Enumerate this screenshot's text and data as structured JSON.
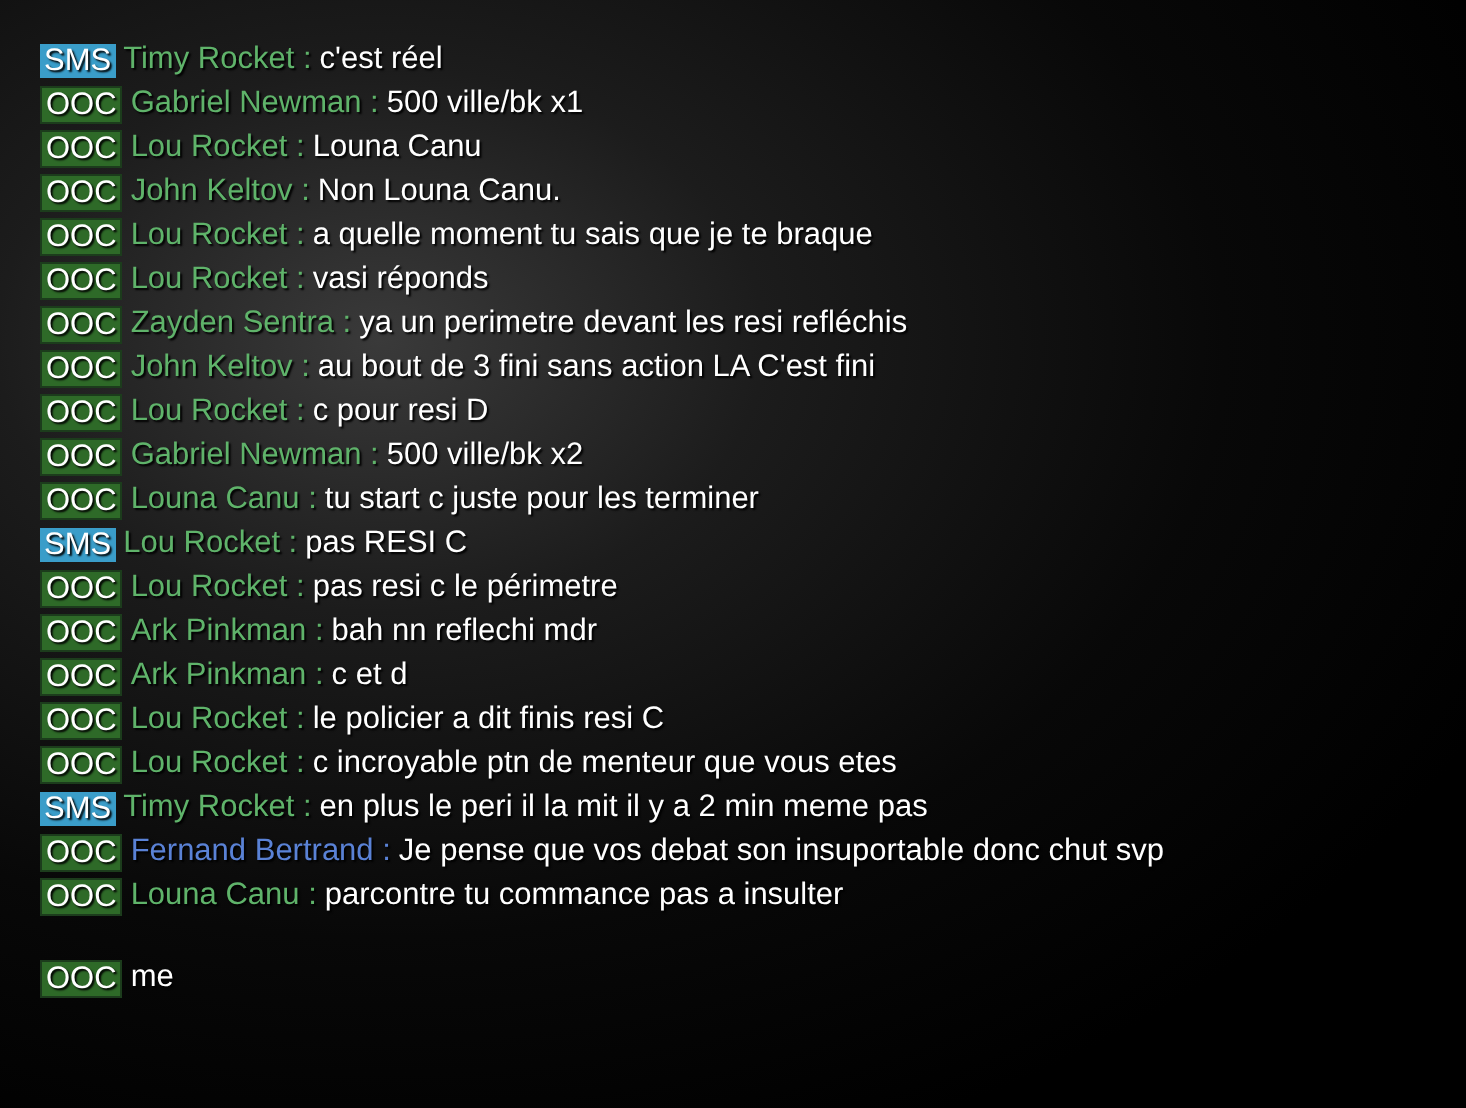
{
  "messages": [
    {
      "channel": "SMS",
      "kind": "sms",
      "name": "Timy Rocket :",
      "color": "#5fb36a",
      "text": "c'est réel"
    },
    {
      "channel": "OOC",
      "kind": "ooc",
      "name": "Gabriel Newman :",
      "color": "#5fb36a",
      "text": "500 ville/bk x1"
    },
    {
      "channel": "OOC",
      "kind": "ooc",
      "name": "Lou Rocket :",
      "color": "#5fb36a",
      "text": "Louna Canu"
    },
    {
      "channel": "OOC",
      "kind": "ooc",
      "name": "John Keltov :",
      "color": "#5fb36a",
      "text": "Non Louna Canu."
    },
    {
      "channel": "OOC",
      "kind": "ooc",
      "name": "Lou Rocket :",
      "color": "#5fb36a",
      "text": "a quelle moment tu sais que je te braque"
    },
    {
      "channel": "OOC",
      "kind": "ooc",
      "name": "Lou Rocket :",
      "color": "#5fb36a",
      "text": "vasi réponds"
    },
    {
      "channel": "OOC",
      "kind": "ooc",
      "name": "Zayden Sentra :",
      "color": "#5fb36a",
      "text": "ya un perimetre devant les resi refléchis"
    },
    {
      "channel": "OOC",
      "kind": "ooc",
      "name": "John Keltov :",
      "color": "#5fb36a",
      "text": "au bout de 3 fini sans action LA C'est fini"
    },
    {
      "channel": "OOC",
      "kind": "ooc",
      "name": "Lou Rocket :",
      "color": "#5fb36a",
      "text": "c pour resi D"
    },
    {
      "channel": "OOC",
      "kind": "ooc",
      "name": "Gabriel Newman :",
      "color": "#5fb36a",
      "text": "500 ville/bk x2"
    },
    {
      "channel": "OOC",
      "kind": "ooc",
      "name": "Louna Canu :",
      "color": "#5fb36a",
      "text": "tu start c juste pour les terminer"
    },
    {
      "channel": "SMS",
      "kind": "sms",
      "name": "Lou Rocket :",
      "color": "#5fb36a",
      "text": "pas RESI C"
    },
    {
      "channel": "OOC",
      "kind": "ooc",
      "name": "Lou Rocket :",
      "color": "#5fb36a",
      "text": "pas resi c le périmetre"
    },
    {
      "channel": "OOC",
      "kind": "ooc",
      "name": "Ark Pinkman :",
      "color": "#5fb36a",
      "text": "bah nn reflechi mdr"
    },
    {
      "channel": "OOC",
      "kind": "ooc",
      "name": "Ark Pinkman :",
      "color": "#5fb36a",
      "text": "c et d"
    },
    {
      "channel": "OOC",
      "kind": "ooc",
      "name": "Lou Rocket :",
      "color": "#5fb36a",
      "text": "le policier a dit finis resi C"
    },
    {
      "channel": "OOC",
      "kind": "ooc",
      "name": "Lou Rocket :",
      "color": "#5fb36a",
      "text": "c incroyable ptn de menteur que vous etes"
    },
    {
      "channel": "SMS",
      "kind": "sms",
      "name": "Timy Rocket :",
      "color": "#5fb36a",
      "text": "en plus le peri il la mit il y a 2 min meme pas"
    },
    {
      "channel": "OOC",
      "kind": "ooc",
      "name": "Fernand Bertrand :",
      "color": "#5a82d6",
      "text": "Je pense que vos debat son insuportable donc chut svp"
    },
    {
      "channel": "OOC",
      "kind": "ooc",
      "name": "Louna Canu :",
      "color": "#5fb36a",
      "text": "parcontre tu commance pas a insulter"
    }
  ],
  "input": {
    "channel": "OOC",
    "kind": "ooc",
    "value": "me"
  }
}
